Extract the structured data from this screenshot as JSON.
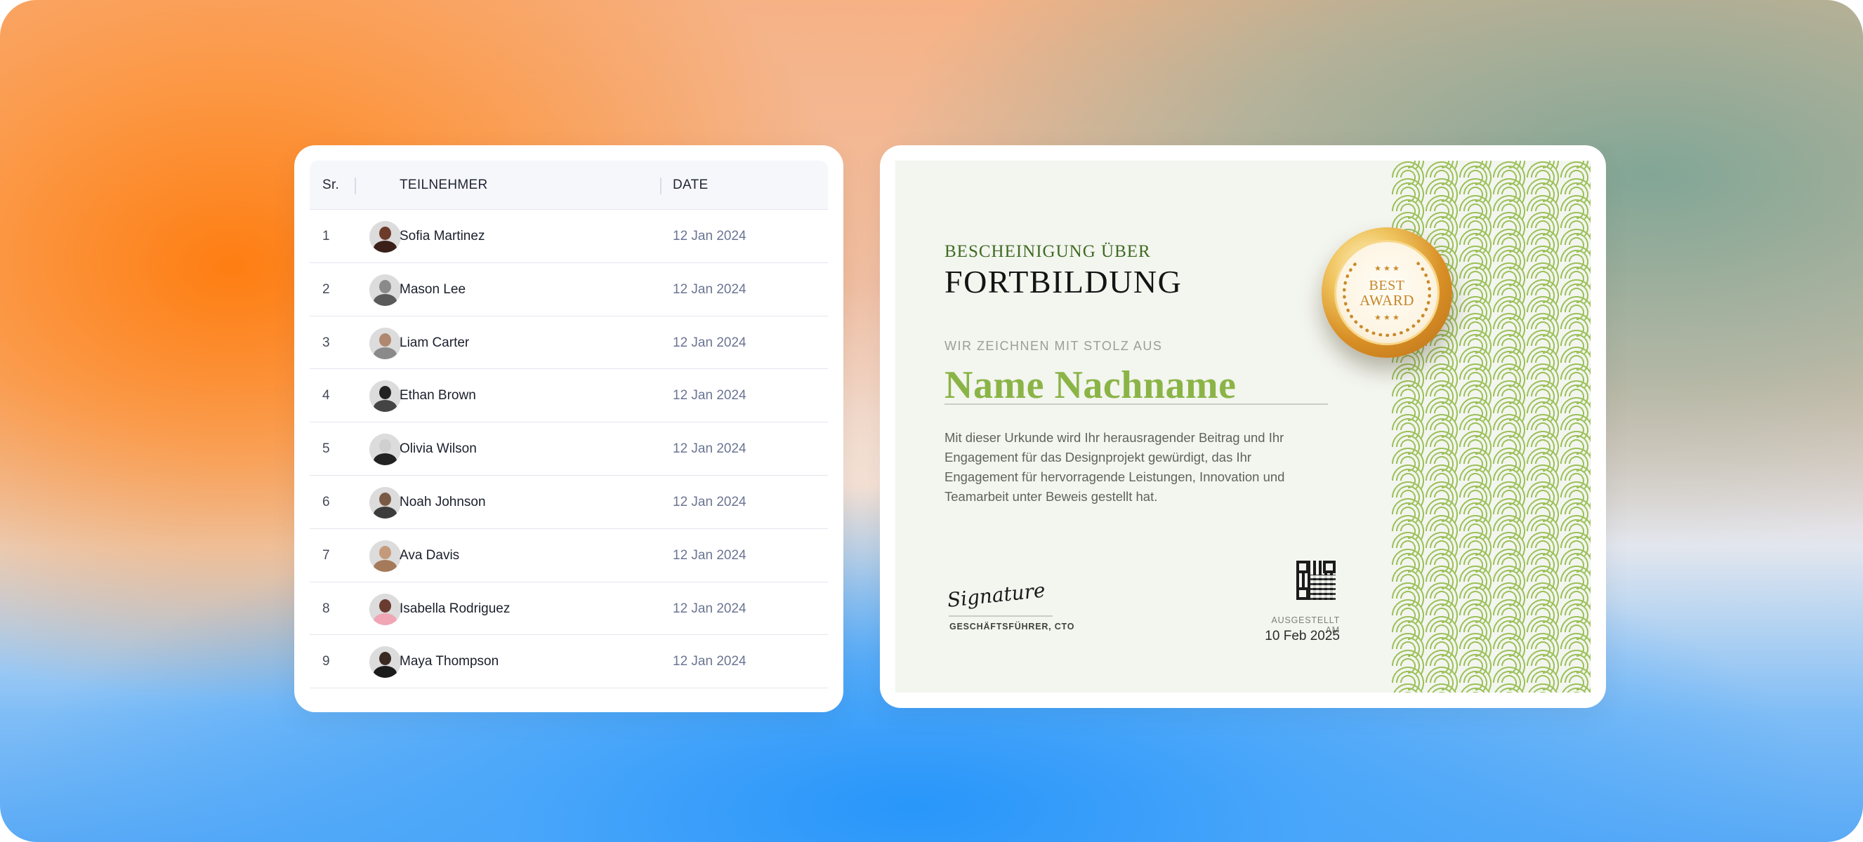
{
  "table": {
    "headers": {
      "sr": "Sr.",
      "name": "TEILNEHMER",
      "date": "DATE"
    },
    "rows": [
      {
        "sr": "1",
        "name": "Sofia Martinez",
        "date": "12 Jan 2024",
        "avatar_colors": [
          "#6d3b2a",
          "#3a2018"
        ]
      },
      {
        "sr": "2",
        "name": "Mason Lee",
        "date": "12 Jan 2024",
        "avatar_colors": [
          "#8a8a8a",
          "#5a5a5a"
        ]
      },
      {
        "sr": "3",
        "name": "Liam Carter",
        "date": "12 Jan 2024",
        "avatar_colors": [
          "#b08870",
          "#8a8a8a"
        ]
      },
      {
        "sr": "4",
        "name": "Ethan Brown",
        "date": "12 Jan 2024",
        "avatar_colors": [
          "#222222",
          "#444444"
        ]
      },
      {
        "sr": "5",
        "name": "Olivia Wilson",
        "date": "12 Jan 2024",
        "avatar_colors": [
          "#cfcfcf",
          "#222222"
        ]
      },
      {
        "sr": "6",
        "name": "Noah Johnson",
        "date": "12 Jan 2024",
        "avatar_colors": [
          "#7a5a45",
          "#3c3c3c"
        ]
      },
      {
        "sr": "7",
        "name": "Ava Davis",
        "date": "12 Jan 2024",
        "avatar_colors": [
          "#c49a7a",
          "#a57a5a"
        ]
      },
      {
        "sr": "8",
        "name": "Isabella Rodriguez",
        "date": "12 Jan 2024",
        "avatar_colors": [
          "#6a3b30",
          "#f0a6b4"
        ]
      },
      {
        "sr": "9",
        "name": "Maya Thompson",
        "date": "12 Jan 2024",
        "avatar_colors": [
          "#3a2a22",
          "#1b1b1b"
        ]
      }
    ]
  },
  "certificate": {
    "kicker": "BESCHEINIGUNG ÜBER",
    "title": "FORTBILDUNG",
    "proud_line": "WIR ZEICHNEN MIT STOLZ AUS",
    "recipient_name": "Name Nachname",
    "description": "Mit dieser Urkunde wird Ihr herausragender Beitrag und Ihr Engagement für das Designprojekt gewürdigt, das Ihr Engagement für hervorragende Leistungen, Innovation und Teamarbeit unter Beweis gestellt hat.",
    "signature_script": "Signature",
    "signature_role": "GESCHÄFTSFÜHRER, CTO",
    "issued_label": "AUSGESTELLT AM",
    "issued_date": "10 Feb 2025",
    "badge": {
      "line1": "BEST",
      "line2": "AWARD",
      "stars": "★ ★ ★"
    },
    "accent_color": "#8bb447",
    "pattern_color": "#9cc15a"
  }
}
